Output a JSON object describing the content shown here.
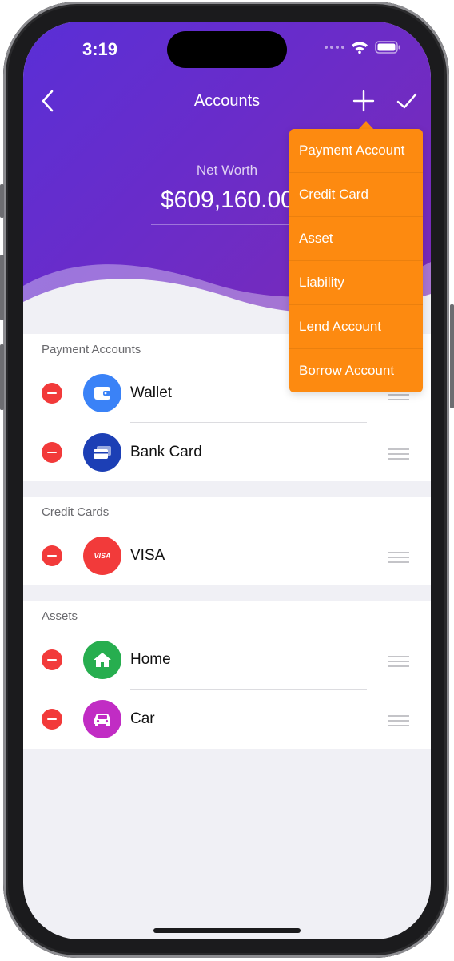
{
  "status_bar": {
    "time": "3:19"
  },
  "nav": {
    "title": "Accounts"
  },
  "net_worth": {
    "label": "Net Worth",
    "value": "$609,160.00"
  },
  "add_menu": {
    "items": [
      "Payment Account",
      "Credit Card",
      "Asset",
      "Liability",
      "Lend Account",
      "Borrow Account"
    ]
  },
  "sections": [
    {
      "title": "Payment Accounts",
      "accounts": [
        {
          "name": "Wallet",
          "icon": "wallet-icon",
          "color": "#3a82f7"
        },
        {
          "name": "Bank Card",
          "icon": "bank-card-icon",
          "color": "#1c3fb5"
        }
      ]
    },
    {
      "title": "Credit Cards",
      "accounts": [
        {
          "name": "VISA",
          "icon": "visa-icon",
          "icon_text": "VISA",
          "color": "#f23a3a"
        }
      ]
    },
    {
      "title": "Assets",
      "accounts": [
        {
          "name": "Home",
          "icon": "home-icon",
          "color": "#27ae4f"
        },
        {
          "name": "Car",
          "icon": "car-icon",
          "color": "#c12cc4"
        }
      ]
    }
  ],
  "colors": {
    "header_gradient_start": "#5a2fd6",
    "header_gradient_end": "#7d2ab4",
    "menu_orange": "#fd8a10",
    "delete_red": "#f23a3a"
  }
}
